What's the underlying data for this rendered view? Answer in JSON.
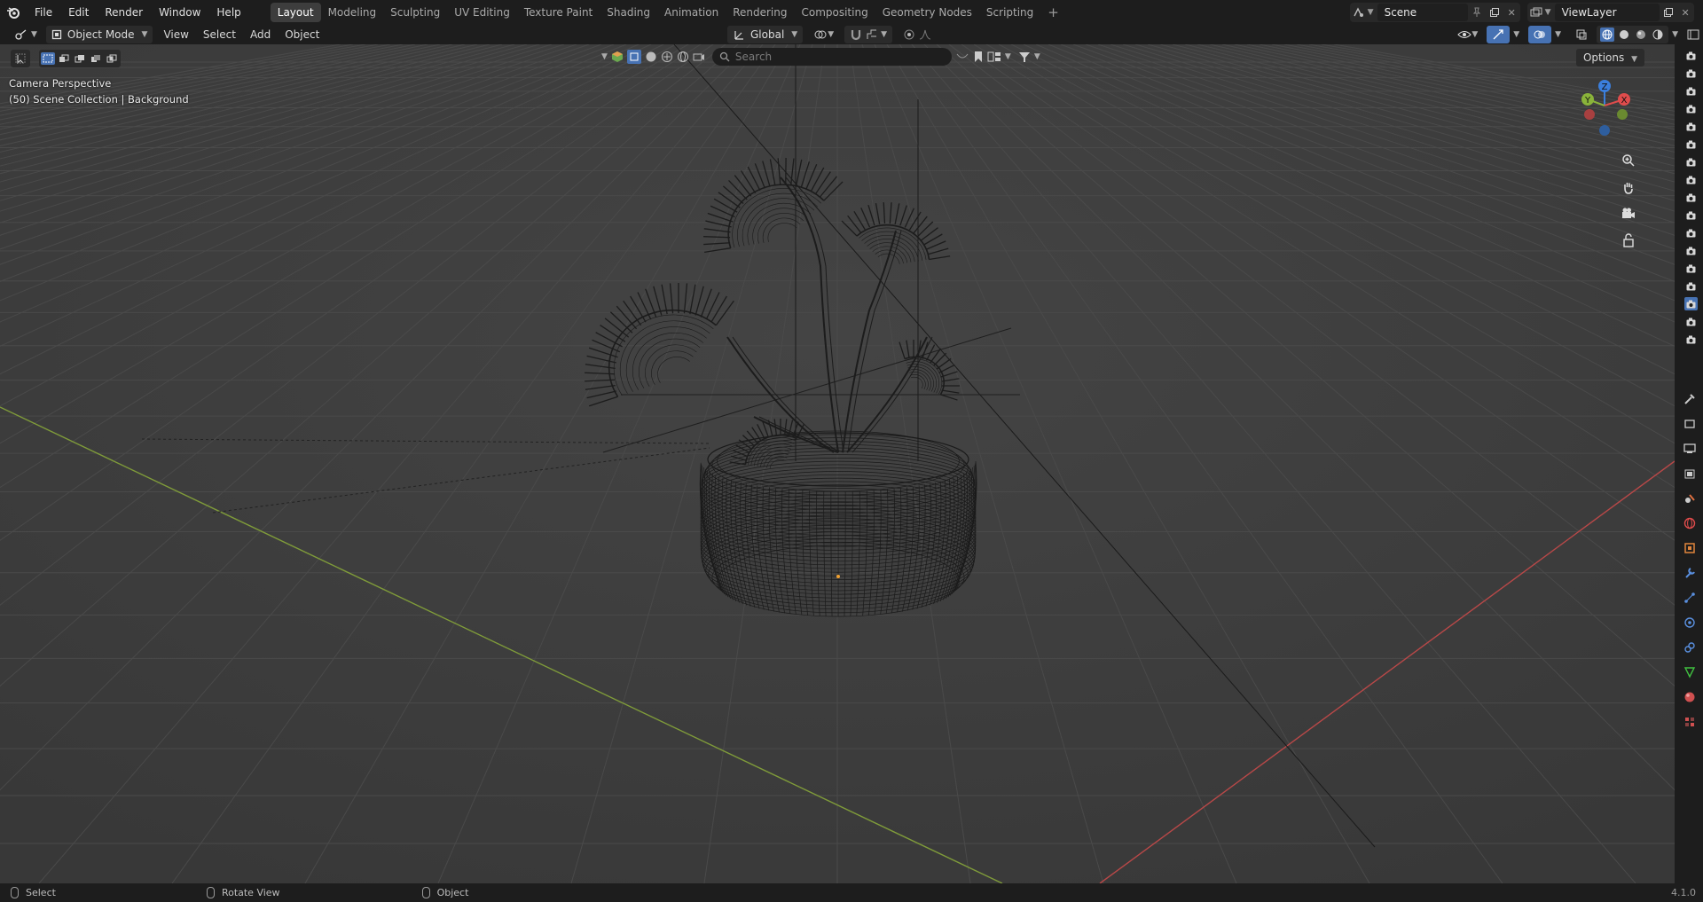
{
  "menu": {
    "file": "File",
    "edit": "Edit",
    "render": "Render",
    "window": "Window",
    "help": "Help"
  },
  "workspaces": [
    "Layout",
    "Modeling",
    "Sculpting",
    "UV Editing",
    "Texture Paint",
    "Shading",
    "Animation",
    "Rendering",
    "Compositing",
    "Geometry Nodes",
    "Scripting"
  ],
  "scene": {
    "name": "Scene",
    "view_layer": "ViewLayer"
  },
  "viewport_header": {
    "mode": "Object Mode",
    "menus": [
      "View",
      "Select",
      "Add",
      "Object"
    ],
    "orientation": "Global",
    "search_placeholder": "Search",
    "options": "Options"
  },
  "overlay": {
    "perspective": "Camera Perspective",
    "collection": "(50) Scene Collection | Background"
  },
  "gizmo": {
    "z": "Z",
    "y": "Y",
    "x": "X"
  },
  "status": {
    "select": "Select",
    "rotate": "Rotate View",
    "object": "Object",
    "version": "4.1.0"
  },
  "colors": {
    "accent": "#4772b3",
    "x_axis": "#e04c4c",
    "y_axis": "#8ab33a",
    "z_axis": "#3b7fdd"
  }
}
